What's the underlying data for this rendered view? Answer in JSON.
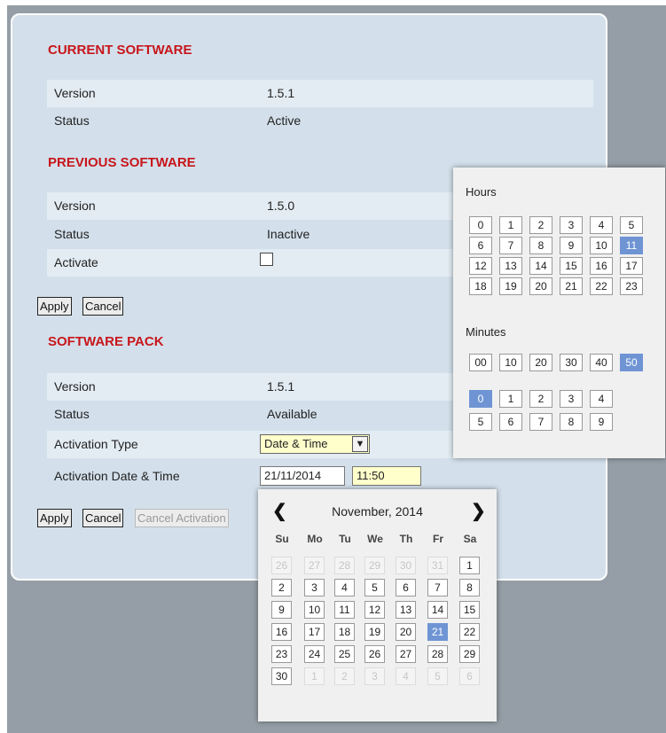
{
  "current": {
    "title": "CURRENT SOFTWARE",
    "version_label": "Version",
    "version_value": "1.5.1",
    "status_label": "Status",
    "status_value": "Active"
  },
  "previous": {
    "title": "PREVIOUS SOFTWARE",
    "version_label": "Version",
    "version_value": "1.5.0",
    "status_label": "Status",
    "status_value": "Inactive",
    "activate_label": "Activate",
    "apply_label": "Apply",
    "cancel_label": "Cancel"
  },
  "pack": {
    "title": "SOFTWARE PACK",
    "version_label": "Version",
    "version_value": "1.5.1",
    "status_label": "Status",
    "status_value": "Available",
    "activation_type_label": "Activation Type",
    "activation_type_value": "Date & Time",
    "activation_dt_label": "Activation Date & Time",
    "date_value": "21/11/2014",
    "time_value": "11:50",
    "apply_label": "Apply",
    "cancel_label": "Cancel",
    "cancel_activation_label": "Cancel Activation"
  },
  "timepicker": {
    "hours_label": "Hours",
    "hours": [
      "0",
      "1",
      "2",
      "3",
      "4",
      "5",
      "6",
      "7",
      "8",
      "9",
      "10",
      "11",
      "12",
      "13",
      "14",
      "15",
      "16",
      "17",
      "18",
      "19",
      "20",
      "21",
      "22",
      "23"
    ],
    "selected_hour": "11",
    "minutes_label": "Minutes",
    "minute_tens": [
      "00",
      "10",
      "20",
      "30",
      "40",
      "50"
    ],
    "selected_minute_tens": "50",
    "minute_ones": [
      "0",
      "1",
      "2",
      "3",
      "4",
      "5",
      "6",
      "7",
      "8",
      "9"
    ],
    "selected_minute_ones": "0",
    "selected_color": "#6f94d4"
  },
  "calendar": {
    "title": "November, 2014",
    "prev_icon": "chevron-left-icon",
    "next_icon": "chevron-right-icon",
    "weekdays": [
      "Su",
      "Mo",
      "Tu",
      "We",
      "Th",
      "Fr",
      "Sa"
    ],
    "weeks": [
      [
        {
          "d": "26",
          "o": true
        },
        {
          "d": "27",
          "o": true
        },
        {
          "d": "28",
          "o": true
        },
        {
          "d": "29",
          "o": true
        },
        {
          "d": "30",
          "o": true
        },
        {
          "d": "31",
          "o": true
        },
        {
          "d": "1"
        }
      ],
      [
        {
          "d": "2"
        },
        {
          "d": "3"
        },
        {
          "d": "4"
        },
        {
          "d": "5"
        },
        {
          "d": "6"
        },
        {
          "d": "7"
        },
        {
          "d": "8"
        }
      ],
      [
        {
          "d": "9"
        },
        {
          "d": "10"
        },
        {
          "d": "11"
        },
        {
          "d": "12"
        },
        {
          "d": "13"
        },
        {
          "d": "14"
        },
        {
          "d": "15"
        }
      ],
      [
        {
          "d": "16"
        },
        {
          "d": "17"
        },
        {
          "d": "18"
        },
        {
          "d": "19"
        },
        {
          "d": "20"
        },
        {
          "d": "21",
          "s": true
        },
        {
          "d": "22"
        }
      ],
      [
        {
          "d": "23"
        },
        {
          "d": "24"
        },
        {
          "d": "25"
        },
        {
          "d": "26"
        },
        {
          "d": "27"
        },
        {
          "d": "28"
        },
        {
          "d": "29"
        }
      ],
      [
        {
          "d": "30"
        },
        {
          "d": "1",
          "o": true
        },
        {
          "d": "2",
          "o": true
        },
        {
          "d": "3",
          "o": true
        },
        {
          "d": "4",
          "o": true
        },
        {
          "d": "5",
          "o": true
        },
        {
          "d": "6",
          "o": true
        }
      ]
    ],
    "selected_day": "21"
  }
}
